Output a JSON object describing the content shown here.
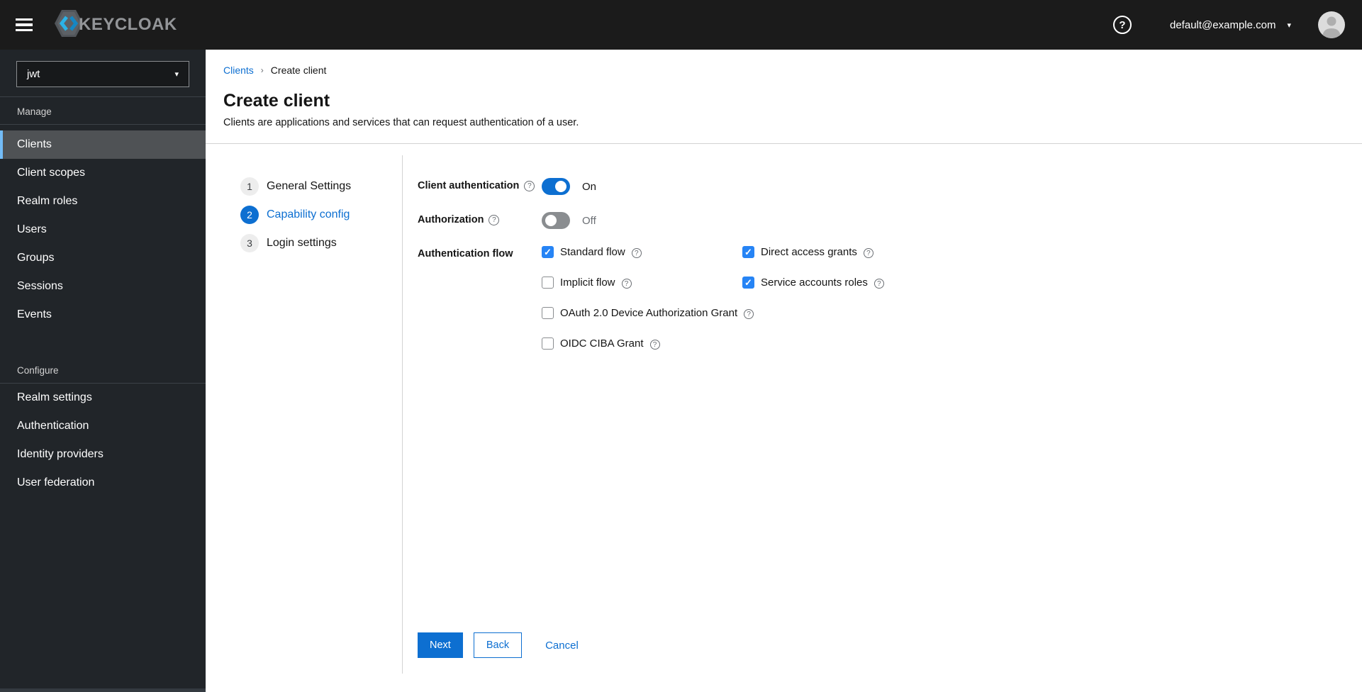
{
  "colors": {
    "accent_blue": "#0d6fd1",
    "checkbox_blue": "#2684f5",
    "masthead_bg": "#1b1b1b",
    "sidebar_bg": "#212529",
    "sidebar_selected_bg": "#4f5255",
    "nav_selected_accent": "#73bcf7"
  },
  "icons": {
    "hamburger": "menu",
    "help": "?",
    "caret_down": "▾",
    "breadcrumb_separator": "›",
    "check": "✓",
    "avatar": "user-silhouette"
  },
  "masthead": {
    "brand_text": "KEYCLOAK",
    "account_email": "default@example.com"
  },
  "sidebar": {
    "realm": "jwt",
    "sections": [
      {
        "label": "Manage",
        "items": [
          {
            "label": "Clients",
            "selected": true
          },
          {
            "label": "Client scopes",
            "selected": false
          },
          {
            "label": "Realm roles",
            "selected": false
          },
          {
            "label": "Users",
            "selected": false
          },
          {
            "label": "Groups",
            "selected": false
          },
          {
            "label": "Sessions",
            "selected": false
          },
          {
            "label": "Events",
            "selected": false
          }
        ]
      },
      {
        "label": "Configure",
        "items": [
          {
            "label": "Realm settings",
            "selected": false
          },
          {
            "label": "Authentication",
            "selected": false
          },
          {
            "label": "Identity providers",
            "selected": false
          },
          {
            "label": "User federation",
            "selected": false
          }
        ]
      }
    ]
  },
  "breadcrumb": {
    "link": "Clients",
    "current": "Create client"
  },
  "page": {
    "title": "Create client",
    "subtitle": "Clients are applications and services that can request authentication of a user."
  },
  "wizard": {
    "steps": [
      {
        "number": "1",
        "label": "General Settings",
        "active": false
      },
      {
        "number": "2",
        "label": "Capability config",
        "active": true
      },
      {
        "number": "3",
        "label": "Login settings",
        "active": false
      }
    ]
  },
  "form": {
    "client_auth": {
      "label": "Client authentication",
      "state": "On",
      "on": true
    },
    "authorization": {
      "label": "Authorization",
      "state": "Off",
      "on": false
    },
    "auth_flow": {
      "label": "Authentication flow",
      "options": [
        {
          "label": "Standard flow",
          "checked": true
        },
        {
          "label": "Direct access grants",
          "checked": true
        },
        {
          "label": "Implicit flow",
          "checked": false
        },
        {
          "label": "Service accounts roles",
          "checked": true
        },
        {
          "label": "OAuth 2.0 Device Authorization Grant",
          "checked": false
        },
        {
          "label": "OIDC CIBA Grant",
          "checked": false
        }
      ]
    },
    "actions": {
      "next": "Next",
      "back": "Back",
      "cancel": "Cancel"
    }
  }
}
